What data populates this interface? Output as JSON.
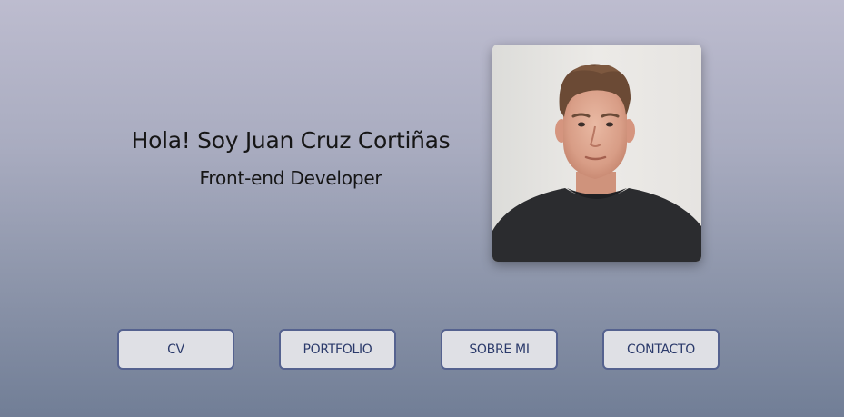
{
  "hero": {
    "name": "Hola! Soy Juan Cruz Cortiñas",
    "role": "Front-end Developer"
  },
  "profile_photo": {
    "alt": "Juan Cruz Cortiñas"
  },
  "nav": {
    "items": [
      {
        "label": "CV"
      },
      {
        "label": "PORTFOLIO"
      },
      {
        "label": "SOBRE MI"
      },
      {
        "label": "CONTACTO"
      }
    ]
  },
  "colors": {
    "button_border": "#55628f",
    "button_bg": "#dfe0e5",
    "button_text": "#2b3a6b",
    "bg_top": "#bdbccf",
    "bg_bottom": "#717e96"
  }
}
